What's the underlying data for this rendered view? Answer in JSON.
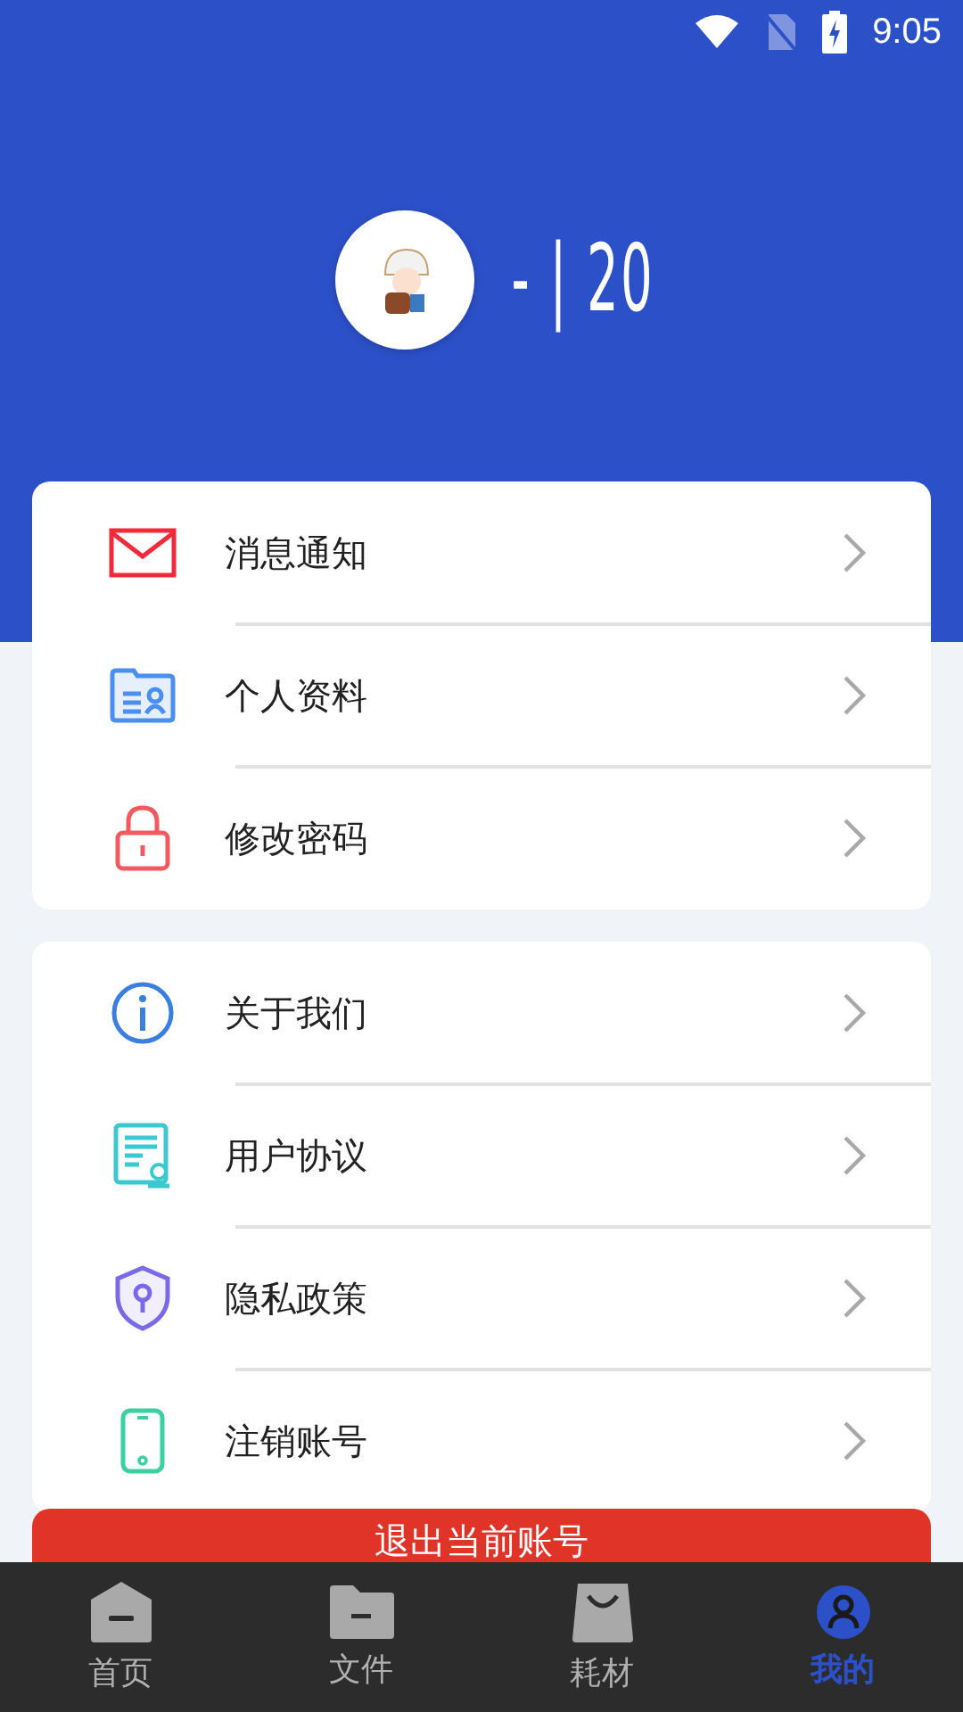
{
  "status_bar": {
    "time": "9:05"
  },
  "profile": {
    "name": "- | 20"
  },
  "menu_groups": [
    {
      "items": [
        {
          "label": "消息通知"
        },
        {
          "label": "个人资料"
        },
        {
          "label": "修改密码"
        }
      ]
    },
    {
      "items": [
        {
          "label": "关于我们"
        },
        {
          "label": "用户协议"
        },
        {
          "label": "隐私政策"
        },
        {
          "label": "注销账号"
        }
      ]
    }
  ],
  "logout_button": {
    "label": "退出当前账号"
  },
  "tabs": [
    {
      "label": "首页",
      "selected": false
    },
    {
      "label": "文件",
      "selected": false
    },
    {
      "label": "耗材",
      "selected": false
    },
    {
      "label": "我的",
      "selected": true
    }
  ]
}
